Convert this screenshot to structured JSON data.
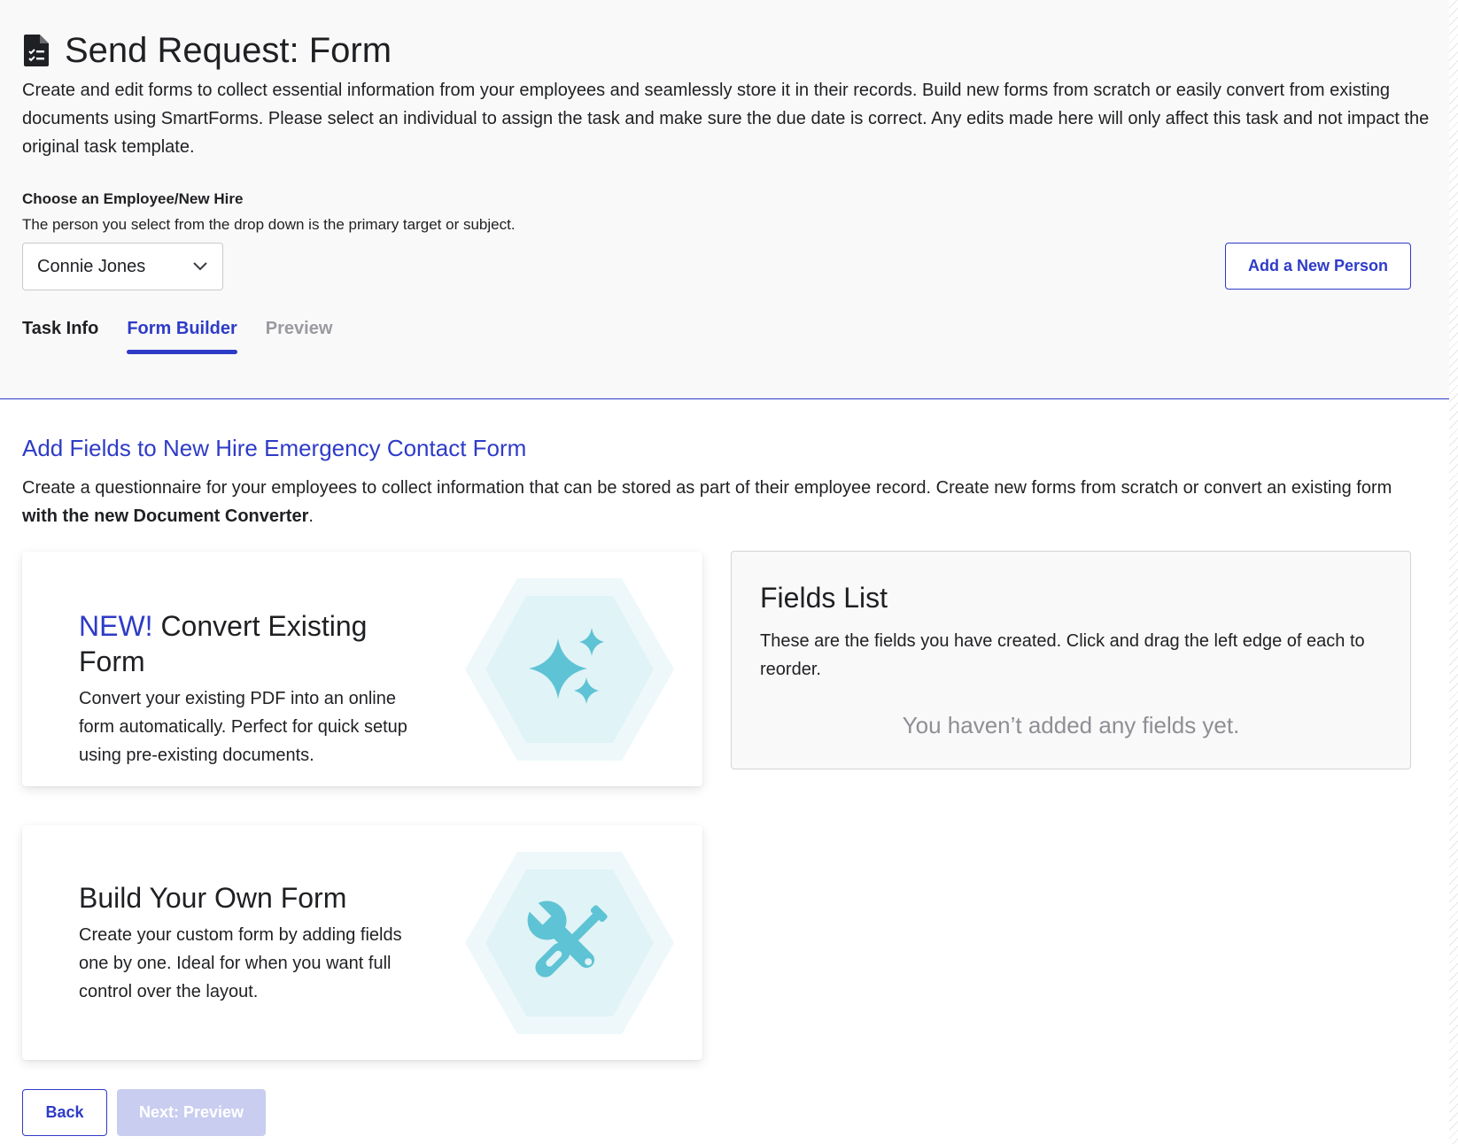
{
  "header": {
    "title": "Send Request: Form",
    "icon": "document-checklist-icon",
    "intro": "Create and edit forms to collect essential information from your employees and seamlessly store it in their records. Build new forms from scratch or easily convert from existing documents using SmartForms. Please select an individual to assign the task and make sure the due date is correct. Any edits made here will only affect this task and not impact the original task template."
  },
  "employee": {
    "label": "Choose an Employee/New Hire",
    "help": "The person you select from the drop down is the primary target or subject.",
    "selected": "Connie Jones",
    "add_button": "Add a New Person"
  },
  "tabs": [
    {
      "label": "Task Info",
      "state": "default"
    },
    {
      "label": "Form Builder",
      "state": "active"
    },
    {
      "label": "Preview",
      "state": "disabled"
    }
  ],
  "section": {
    "title": "Add Fields to New Hire Emergency Contact Form",
    "desc_prefix": "Create a questionnaire for your employees to collect information that can be stored as part of their employee record. Create new forms from scratch or convert an existing form ",
    "desc_bold": "with the new Document Converter",
    "desc_suffix": "."
  },
  "cards": {
    "convert": {
      "badge": "NEW!",
      "title": " Convert Existing Form",
      "desc": "Convert your existing PDF into an online form automatically. Perfect for quick setup using pre-existing documents.",
      "icon": "sparkles-icon"
    },
    "build": {
      "title": "Build Your Own Form",
      "desc": "Create your custom form by adding fields one by one. Ideal for when you want full control over the layout.",
      "icon": "tools-icon"
    }
  },
  "fields_list": {
    "title": "Fields List",
    "desc": "These are the fields you have created. Click and drag the left edge of each to reorder.",
    "empty": "You haven’t added any fields yet."
  },
  "footer": {
    "back": "Back",
    "next": "Next: Preview"
  },
  "colors": {
    "primary": "#2e3bc7",
    "accent_icon": "#5ec3d4",
    "hex_outer": "#eef8fa",
    "hex_inner": "#e0f3f6",
    "disabled_button": "#c9cdf0"
  }
}
